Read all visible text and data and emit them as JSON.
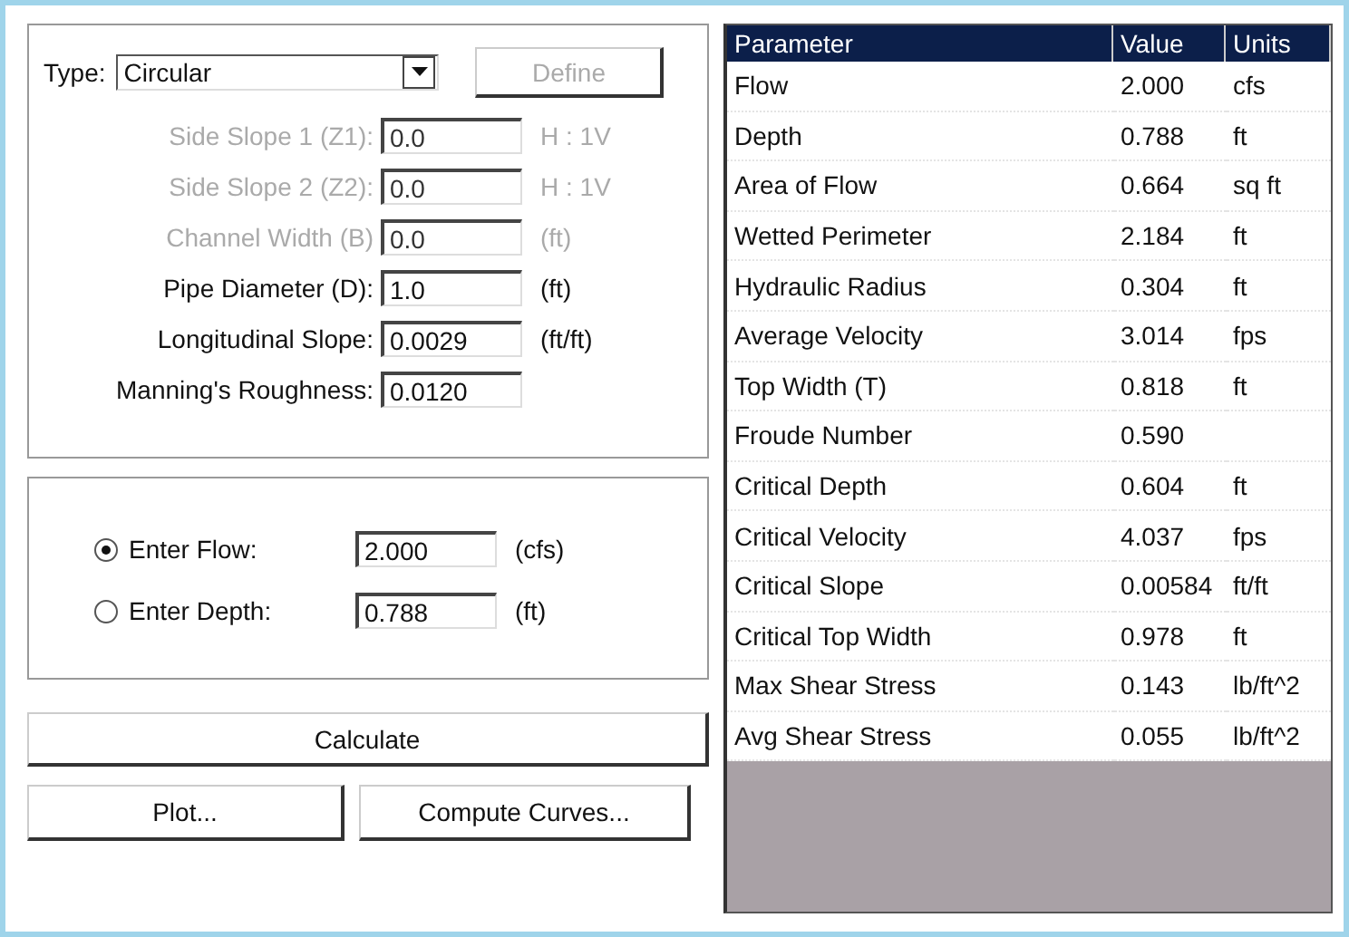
{
  "type_select": {
    "label": "Type:",
    "value": "Circular"
  },
  "define_button": {
    "label": "Define",
    "disabled": true
  },
  "inputs": [
    {
      "label": "Side Slope 1 (Z1):",
      "value": "0.0",
      "units": "H : 1V",
      "disabled": true
    },
    {
      "label": "Side Slope 2 (Z2):",
      "value": "0.0",
      "units": "H : 1V",
      "disabled": true
    },
    {
      "label": "Channel Width (B)",
      "value": "0.0",
      "units": "(ft)",
      "disabled": true
    },
    {
      "label": "Pipe Diameter (D):",
      "value": "1.0",
      "units": "(ft)",
      "disabled": false
    },
    {
      "label": "Longitudinal Slope:",
      "value": "0.0029",
      "units": "(ft/ft)",
      "disabled": false
    },
    {
      "label": "Manning's Roughness:",
      "value": "0.0120",
      "disabled": false
    }
  ],
  "solve_for": [
    {
      "label": "Enter Flow:",
      "value": "2.000",
      "units": "(cfs)",
      "selected": true
    },
    {
      "label": "Enter Depth:",
      "value": "0.788",
      "units": "(ft)",
      "selected": false
    }
  ],
  "calculate_button": "Calculate",
  "buttons": [
    "Plot...",
    "Compute Curves..."
  ],
  "table": {
    "columns": [
      "Parameter",
      "Value",
      "Units"
    ],
    "rows": [
      [
        "Flow",
        "2.000",
        "cfs"
      ],
      [
        "Depth",
        "0.788",
        "ft"
      ],
      [
        "Area of Flow",
        "0.664",
        "sq ft"
      ],
      [
        "Wetted Perimeter",
        "2.184",
        "ft"
      ],
      [
        "Hydraulic Radius",
        "0.304",
        "ft"
      ],
      [
        "Average Velocity",
        "3.014",
        "fps"
      ],
      [
        "Top Width (T)",
        "0.818",
        "ft"
      ],
      [
        "Froude Number",
        "0.590",
        ""
      ],
      [
        "Critical Depth",
        "0.604",
        "ft"
      ],
      [
        "Critical Velocity",
        "4.037",
        "fps"
      ],
      [
        "Critical Slope",
        "0.00584",
        "ft/ft"
      ],
      [
        "Critical Top Width",
        "0.978",
        "ft"
      ],
      [
        "Max Shear Stress",
        "0.143",
        "lb/ft^2"
      ],
      [
        "Avg Shear Stress",
        "0.055",
        "lb/ft^2"
      ]
    ]
  }
}
